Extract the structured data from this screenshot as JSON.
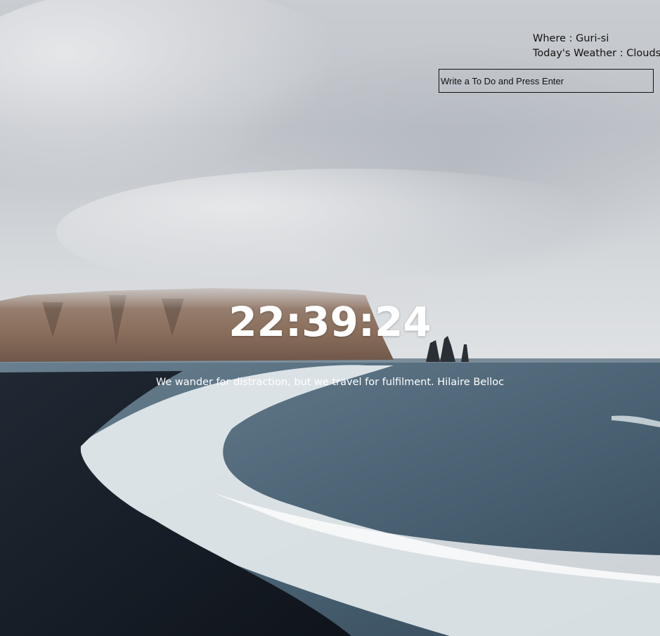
{
  "weather": {
    "location_label": "Where : ",
    "location": "Guri-si",
    "weather_label": "Today's Weather : ",
    "condition": "Clouds"
  },
  "todo": {
    "placeholder": "Write a To Do and Press Enter",
    "value": ""
  },
  "clock": {
    "time": "22:39:24"
  },
  "quote": {
    "text": "We wander for distraction, but we travel for fulfilment.",
    "author": "Hilaire Belloc"
  },
  "background": {
    "sky": "#cfd3d8",
    "sea": "#4d6677",
    "sand": "#161c24",
    "cliff": "#8a6e5c",
    "foam": "#f2f4f5"
  }
}
